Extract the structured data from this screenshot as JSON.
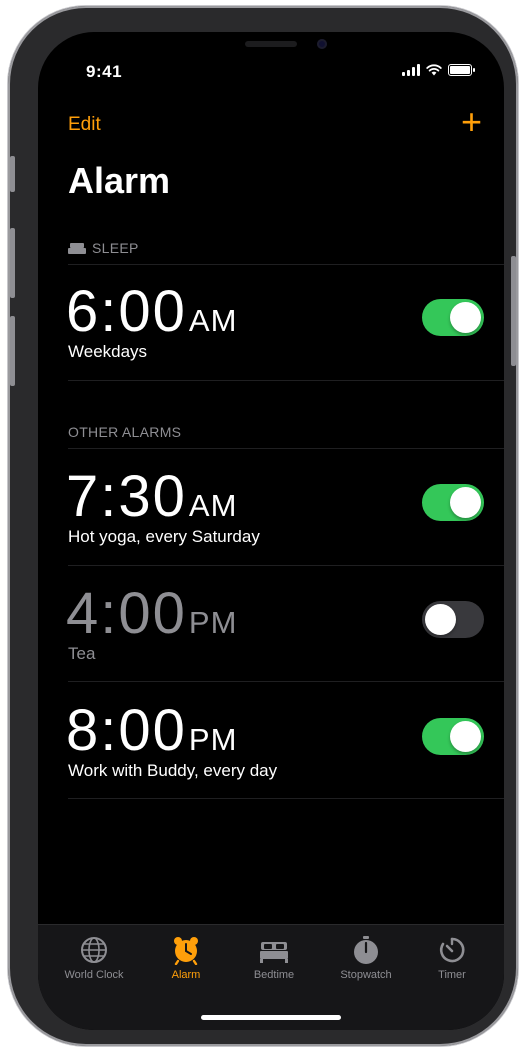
{
  "status_bar": {
    "time": "9:41"
  },
  "nav": {
    "edit_label": "Edit",
    "add_label": "+"
  },
  "page": {
    "title": "Alarm"
  },
  "sections": {
    "sleep_header": "SLEEP",
    "other_header": "OTHER ALARMS"
  },
  "alarms": [
    {
      "time": "6:00",
      "ampm": "AM",
      "label": "Weekdays",
      "enabled": true
    },
    {
      "time": "7:30",
      "ampm": "AM",
      "label": "Hot yoga, every Saturday",
      "enabled": true
    },
    {
      "time": "4:00",
      "ampm": "PM",
      "label": "Tea",
      "enabled": false
    },
    {
      "time": "8:00",
      "ampm": "PM",
      "label": "Work with Buddy, every day",
      "enabled": true
    }
  ],
  "tabs": [
    {
      "label": "World Clock",
      "icon": "globe-icon",
      "active": false
    },
    {
      "label": "Alarm",
      "icon": "alarm-clock-icon",
      "active": true
    },
    {
      "label": "Bedtime",
      "icon": "bed-icon",
      "active": false
    },
    {
      "label": "Stopwatch",
      "icon": "stopwatch-icon",
      "active": false
    },
    {
      "label": "Timer",
      "icon": "timer-icon",
      "active": false
    }
  ],
  "colors": {
    "accent": "#ff9f0a",
    "toggle_on": "#34c759",
    "toggle_off": "#39393d",
    "secondary_text": "#8e8e93",
    "background": "#000000"
  }
}
